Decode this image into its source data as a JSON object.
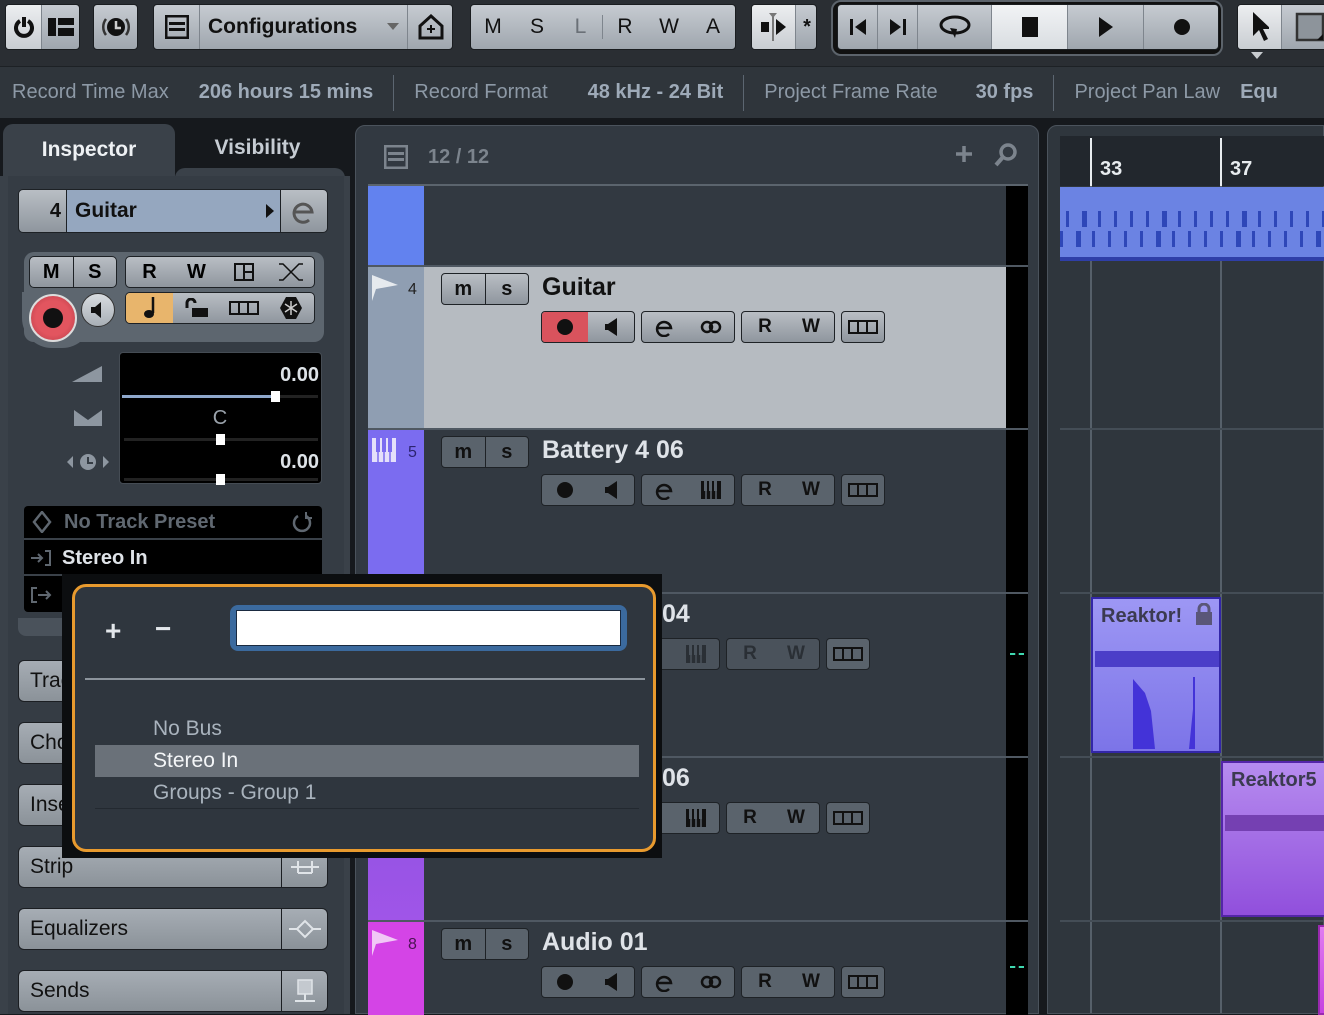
{
  "toolbar": {
    "configurations_label": "Configurations",
    "automation_modes": [
      "M",
      "S",
      "L",
      "R",
      "W",
      "A"
    ],
    "icons": {
      "power": "power-icon",
      "layout": "layout-icon",
      "constrain": "constrain-delay-icon",
      "list": "list-icon",
      "home": "home-icon",
      "snap": "snap-icon",
      "goto_start": "skip-start-icon",
      "goto_end": "skip-end-icon",
      "cycle": "cycle-icon",
      "stop": "stop-icon",
      "play": "play-icon",
      "record": "record-icon",
      "pointer": "pointer-icon",
      "range": "range-tool-icon"
    }
  },
  "status_bar": {
    "record_time_label": "Record Time Max",
    "record_time_value": "206 hours 15 mins",
    "record_format_label": "Record Format",
    "record_format_value": "48 kHz - 24 Bit",
    "frame_rate_label": "Project Frame Rate",
    "frame_rate_value": "30 fps",
    "pan_law_label": "Project Pan Law",
    "pan_law_value": "Equ"
  },
  "inspector": {
    "tabs": [
      "Inspector",
      "Visibility"
    ],
    "active_tab": "Inspector",
    "track_number": "4",
    "track_name": "Guitar",
    "buttons_row1": [
      "M",
      "S",
      "R",
      "W"
    ],
    "volume_value": "0.00",
    "volume_fraction": 0.78,
    "pan_value": "C",
    "delay_value": "0.00",
    "track_preset": "No Track Preset",
    "input_routing": "Stereo In",
    "sections": [
      "Tracks",
      "Chords",
      "Inserts",
      "Strip",
      "Equalizers",
      "Sends"
    ]
  },
  "track_list": {
    "count_label": "12 / 12",
    "tracks": [
      {
        "number": "",
        "name": "",
        "color": "#6282ef",
        "selected": false
      },
      {
        "number": "4",
        "name": "Guitar",
        "color": "#8f9eb2",
        "type": "audio",
        "selected": true,
        "record_armed": true
      },
      {
        "number": "5",
        "name": "Battery 4 06",
        "color": "#7b6cf0",
        "type": "instrument",
        "selected": false
      },
      {
        "number": "",
        "name": "04",
        "color": "#8a5fe8",
        "type": "instrument",
        "selected": false
      },
      {
        "number": "",
        "name": "06",
        "color": "#9b55e6",
        "type": "instrument",
        "selected": false
      },
      {
        "number": "8",
        "name": "Audio 01",
        "color": "#d444e6",
        "type": "audio",
        "selected": false
      }
    ]
  },
  "ruler": {
    "bars": [
      "33",
      "37"
    ]
  },
  "events": [
    {
      "name": "Reaktor!",
      "color": "#8c86ee",
      "locked": true
    },
    {
      "name": "Reaktor5",
      "color": "#a472e4",
      "locked": false
    }
  ],
  "bus_popup": {
    "add_label": "+",
    "remove_label": "−",
    "search_value": "",
    "items": [
      "No Bus",
      "Stereo In",
      "Groups - Group 1"
    ],
    "selected": "Stereo In"
  }
}
